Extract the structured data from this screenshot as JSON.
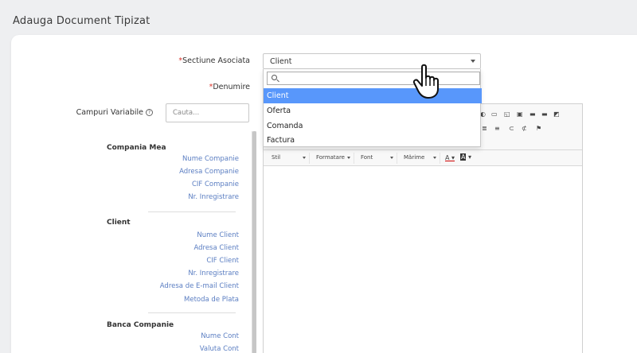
{
  "page": {
    "title": "Adauga Document Tipizat"
  },
  "form": {
    "sectiune": {
      "label": "Sectiune Asociata",
      "value": "Client"
    },
    "denumire": {
      "label": "Denumire"
    },
    "campuri": {
      "label": "Campuri Variabile",
      "search_placeholder": "Cauta..."
    }
  },
  "dropdown": {
    "options": [
      "Client",
      "Oferta",
      "Comanda",
      "Factura"
    ],
    "selected_index": 0,
    "highlight_color": "#5897fb"
  },
  "variables": {
    "groups": [
      {
        "title": "Compania Mea",
        "items": [
          "Nume Companie",
          "Adresa Companie",
          "CIF Companie",
          "Nr. Inregistrare"
        ]
      },
      {
        "title": "Client",
        "items": [
          "Nume Client",
          "Adresa Client",
          "CIF Client",
          "Nr. Inregistrare",
          "Adresa de E-mail Client",
          "Metoda de Plata"
        ]
      },
      {
        "title": "Banca Companie",
        "items": [
          "Nume Cont",
          "Valuta Cont"
        ]
      }
    ]
  },
  "editor": {
    "combos": [
      "Stil",
      "Formatare",
      "Font",
      "Mărime"
    ],
    "icons": [
      "image-icon",
      "table-icon",
      "horizontal-line-icon",
      "smiley-icon",
      "special-char-icon",
      "page-break-icon",
      "iframe-icon",
      "align-icon",
      "justify-icon",
      "link-icon",
      "unlink-icon",
      "anchor-icon",
      "text-color-icon",
      "bg-color-icon"
    ]
  },
  "colors": {
    "required": "#d9342b",
    "link": "#5b7ec2"
  }
}
